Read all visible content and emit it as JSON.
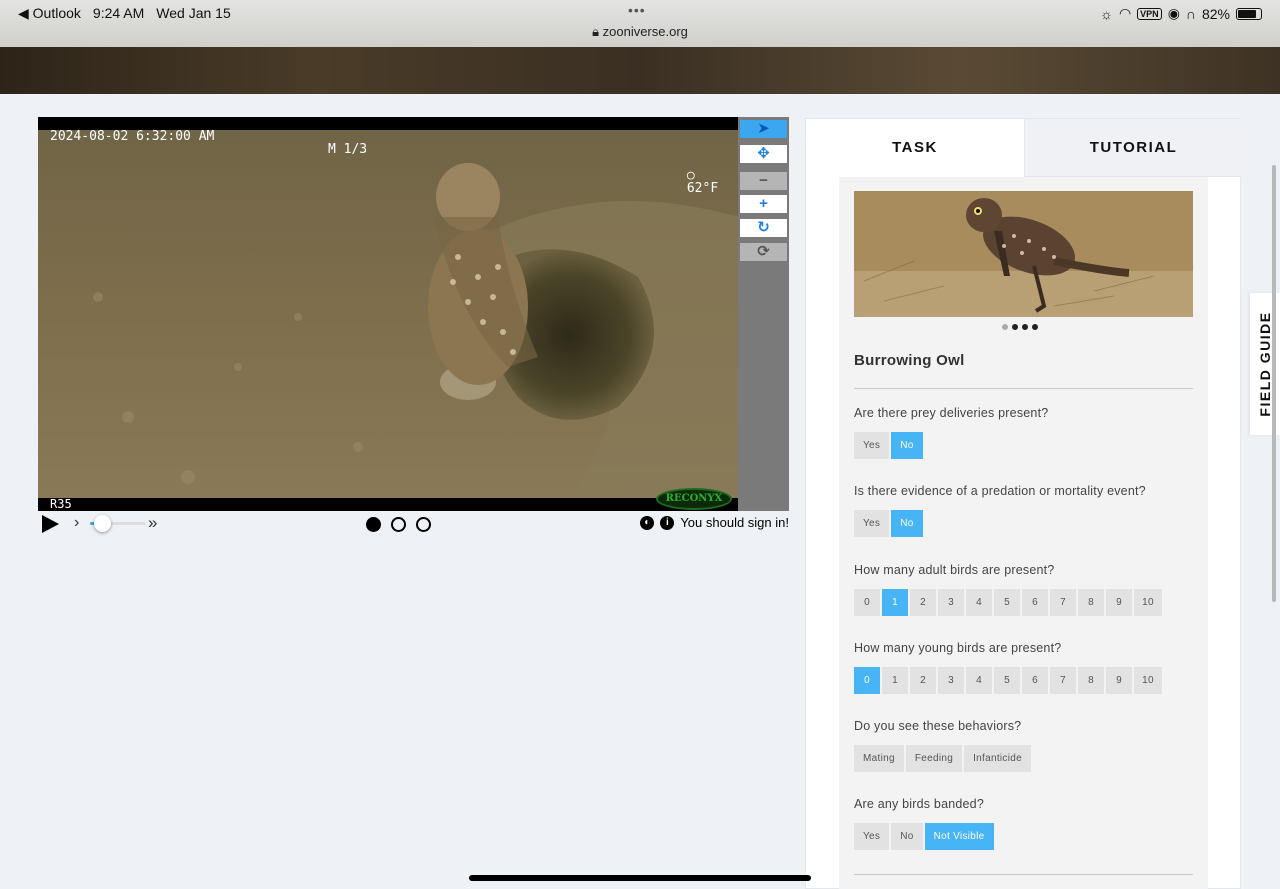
{
  "status_bar": {
    "back_app": "◀ Outlook",
    "time": "9:24 AM",
    "date": "Wed Jan 15",
    "url": "zooniverse.org",
    "vpn": "VPN",
    "battery": "82%",
    "battery_level": 0.82
  },
  "camera": {
    "timestamp": "2024-08-02 6:32:00 AM",
    "mode": "M 1/3",
    "moon": "○",
    "temperature": "62°F",
    "camera_id": "R35",
    "brand": "RECONYX"
  },
  "viewer_tools": {
    "pointer": "➤",
    "move": "✥",
    "zoom_out": "−",
    "zoom_in": "+",
    "rotate": "↻",
    "reset": "⟳"
  },
  "playback": {
    "speed_level": 0.2,
    "frames": 3,
    "current_frame": 1,
    "sign_in_text": "You should sign in!"
  },
  "tabs": {
    "task": "TASK",
    "tutorial": "TUTORIAL"
  },
  "field_guide": "FIELD GUIDE",
  "species_example": {
    "name": "Burrowing Owl",
    "image_count": 4,
    "current_image": 1
  },
  "questions": [
    {
      "text": "Are there prey deliveries present?",
      "options": [
        "Yes",
        "No"
      ],
      "selected": "No"
    },
    {
      "text": "Is there evidence of a predation or mortality event?",
      "options": [
        "Yes",
        "No"
      ],
      "selected": "No"
    },
    {
      "text": "How many adult birds are present?",
      "options": [
        "0",
        "1",
        "2",
        "3",
        "4",
        "5",
        "6",
        "7",
        "8",
        "9",
        "10"
      ],
      "selected": "1"
    },
    {
      "text": "How many young birds are present?",
      "options": [
        "0",
        "1",
        "2",
        "3",
        "4",
        "5",
        "6",
        "7",
        "8",
        "9",
        "10"
      ],
      "selected": "0"
    },
    {
      "text": "Do you see these behaviors?",
      "options": [
        "Mating",
        "Feeding",
        "Infanticide"
      ],
      "selected": ""
    },
    {
      "text": "Are any birds banded?",
      "options": [
        "Yes",
        "No",
        "Not Visible"
      ],
      "selected": "Not Visible"
    }
  ],
  "colors": {
    "accent": "#47b4f5",
    "tool_blue": "#1e7fe0",
    "panel_bg": "#f3f3f3",
    "page_bg": "#eef1f5"
  }
}
